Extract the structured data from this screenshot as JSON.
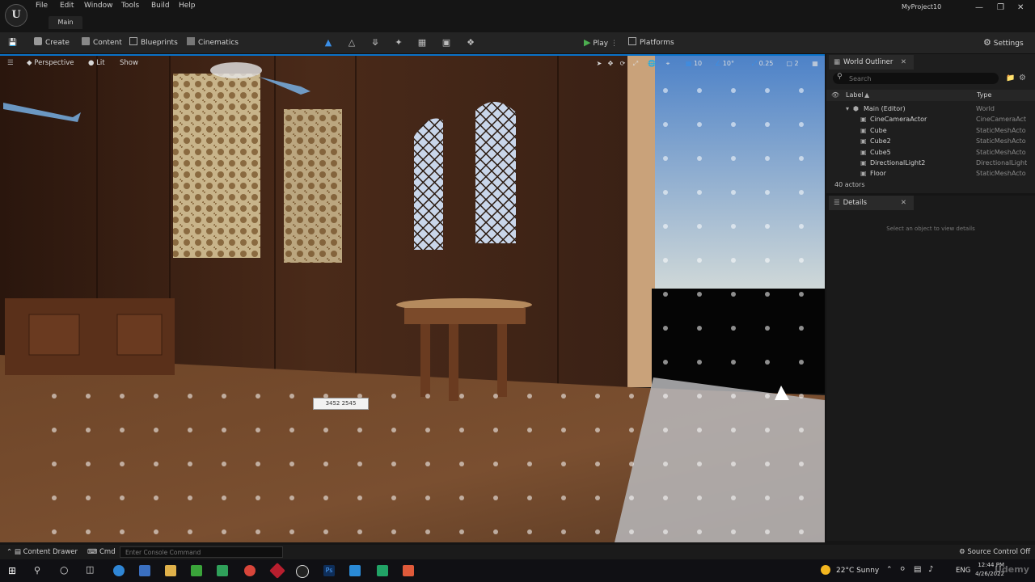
{
  "menu": {
    "items": [
      "File",
      "Edit",
      "Window",
      "Tools",
      "Build",
      "Help"
    ],
    "tab": "Main",
    "project_name": "MyProject10",
    "logo": "U"
  },
  "toolbar": {
    "create": "Create",
    "content": "Content",
    "blueprints": "Blueprints",
    "cinematics": "Cinematics",
    "play": "Play",
    "platforms": "Platforms",
    "settings": "Settings"
  },
  "viewport": {
    "perspective": "Perspective",
    "lit": "Lit",
    "show": "Show",
    "grid_snap": "10",
    "rotation_snap": "10°",
    "scale_snap": "0.25",
    "camera_speed": "2",
    "measure_label": "3452 2545"
  },
  "outliner": {
    "title": "World Outliner",
    "search_placeholder": "Search",
    "col_label": "Label",
    "col_type": "Type",
    "rows": [
      {
        "label": "Main (Editor)",
        "type": "World"
      },
      {
        "label": "CineCameraActor",
        "type": "CineCameraAct"
      },
      {
        "label": "Cube",
        "type": "StaticMeshActo"
      },
      {
        "label": "Cube2",
        "type": "StaticMeshActo"
      },
      {
        "label": "Cube5",
        "type": "StaticMeshActo"
      },
      {
        "label": "DirectionalLight2",
        "type": "DirectionalLight"
      },
      {
        "label": "Floor",
        "type": "StaticMeshActo"
      }
    ],
    "actor_count": "40 actors"
  },
  "details": {
    "title": "Details",
    "empty_hint": "Select an object to view details"
  },
  "bottom": {
    "content_drawer": "Content Drawer",
    "cmd": "Cmd",
    "console_placeholder": "Enter Console Command",
    "source_control": "Source Control Off"
  },
  "taskbar": {
    "weather": "22°C  Sunny",
    "lang": "ENG",
    "time": "12:44 PM",
    "date": "4/26/2022",
    "watermark": "Udemy"
  },
  "colors": {
    "accent": "#0a72c8",
    "play_green": "#4caf50",
    "panel_bg": "#1e1e1e"
  }
}
